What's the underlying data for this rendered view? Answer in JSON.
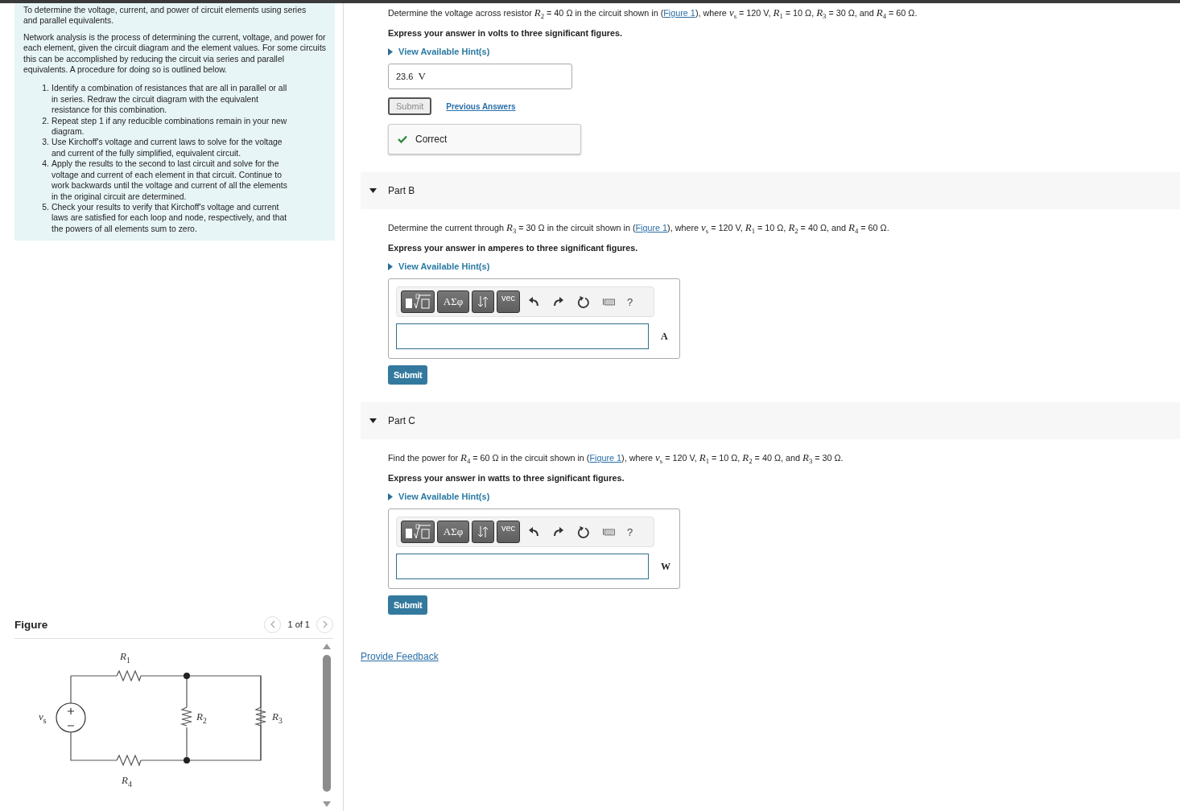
{
  "intro": {
    "cut_line": "To determine the voltage, current, and power of circuit elements using series",
    "lead_end": "and parallel equivalents.",
    "paragraph": "Network analysis is the process of determining the current, voltage, and power for each element, given the circuit diagram and the element values. For some circuits this can be accomplished by reducing the circuit via series and parallel equivalents. A procedure for doing so is outlined below.",
    "steps": [
      {
        "number": "1.",
        "text": "Identify a combination of resistances that are all in parallel or all in series. Redraw the circuit diagram with the equivalent resistance for this combination."
      },
      {
        "number": "2.",
        "text": "Repeat step 1 if any reducible combinations remain in your new diagram."
      },
      {
        "number": "3.",
        "text": "Use Kirchoff's voltage and current laws to solve for the voltage and current of the fully simplified, equivalent circuit."
      },
      {
        "number": "4.",
        "text": "Apply the results to the second to last circuit and solve for the voltage and current of each element in that circuit. Continue to work backwards until the voltage and current of all the elements in the original circuit are determined."
      },
      {
        "number": "5.",
        "text": "Check your results to verify that Kirchoff's voltage and current laws are satisfied for each loop and node, respectively, and that the powers of all elements sum to zero."
      }
    ]
  },
  "figure": {
    "title": "Figure",
    "pager": "1 of 1",
    "labels": {
      "r1": "*R*$_{1}$",
      "r2": "*R*$_{2}$",
      "r3": "*R*$_{3}$",
      "r4": "*R*$_{4}$",
      "vs": "*v*$_{s}$"
    }
  },
  "parts": [
    {
      "kind": "answered",
      "question_prefix": "Determine the voltage across resistor *R*$_{2}$ = 40 Ω in the circuit shown in (",
      "link": "Figure 1",
      "question_suffix": "), where *v*$_{s}$ = 120 V, *R*$_{1}$ = 10 Ω, *R*$_{3}$ = 30 Ω, and *R*$_{4}$ = 60 Ω.",
      "instruction": "Express your answer in volts to three significant figures.",
      "hint": {
        "label": "View Available Hint(s)",
        "expanded": false
      },
      "answer": {
        "value": "23.6",
        "unit": "V"
      },
      "submit": {
        "label": "Submit",
        "disabled": true
      },
      "previous_answers": "Previous Answers",
      "feedback": "Correct"
    },
    {
      "kind": "entry",
      "title": "Part B",
      "expanded": true,
      "question_prefix": "Determine the current through *R*$_{3}$ = 30 Ω in the circuit shown in (",
      "link": "Figure 1",
      "question_suffix": "), where *v*$_{s}$ = 120 V, *R*$_{1}$ = 10 Ω, *R*$_{2}$ = 40 Ω, and *R*$_{4}$ = 60 Ω.",
      "instruction": "Express your answer in amperes to three significant figures.",
      "hint": {
        "label": "View Available Hint(s)",
        "expanded": false
      },
      "toolbar": {
        "greek": "ΑΣφ",
        "vec": "vec",
        "help": "?"
      },
      "unit": "A",
      "submit": {
        "label": "Submit",
        "disabled": false
      }
    },
    {
      "kind": "entry",
      "title": "Part C",
      "expanded": true,
      "question_prefix": "Find the power for *R*$_{4}$ = 60 Ω in the circuit shown in (",
      "link": "Figure 1",
      "question_suffix": "), where *v*$_{s}$ = 120 V, *R*$_{1}$ = 10 Ω, *R*$_{2}$ = 40 Ω, and *R*$_{3}$ = 30 Ω.",
      "instruction": "Express your answer in watts to three significant figures.",
      "hint": {
        "label": "View Available Hint(s)",
        "expanded": false
      },
      "toolbar": {
        "greek": "ΑΣφ",
        "vec": "vec",
        "help": "?"
      },
      "unit": "W",
      "submit": {
        "label": "Submit",
        "disabled": false
      }
    }
  ],
  "feedback_link": "Provide Feedback"
}
